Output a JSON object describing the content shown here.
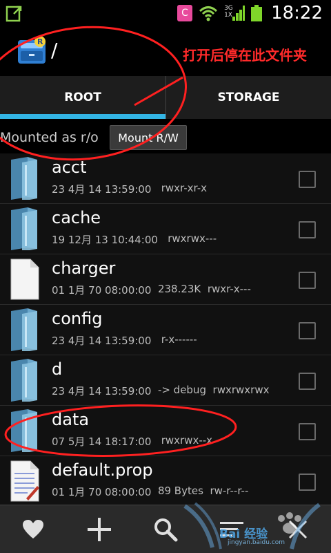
{
  "status_bar": {
    "time": "18:22",
    "network": "3G",
    "network2": "1X",
    "app_badge": "C",
    "colors": {
      "app_badge": "#e84a9c",
      "signal": "#7fd62a",
      "battery": "#7fd62a"
    }
  },
  "action_bar": {
    "path": "/",
    "annotation": "打开后停在此文件夹"
  },
  "tabs": [
    {
      "label": "ROOT",
      "active": true
    },
    {
      "label": "STORAGE",
      "active": false
    }
  ],
  "mount": {
    "status": "Mounted as r/o",
    "button_label": "Mount R/W"
  },
  "files": [
    {
      "name": "acct",
      "icon": "folder-icon",
      "date": "23 4月 14 13:59:00",
      "size": "",
      "perms": "rwxr-xr-x"
    },
    {
      "name": "cache",
      "icon": "folder-icon",
      "date": "19 12月 13 10:44:00",
      "size": "",
      "perms": "rwxrwx---"
    },
    {
      "name": "charger",
      "icon": "file-icon",
      "date": "01 1月 70 08:00:00",
      "size": "238.23K",
      "perms": "rwxr-x---"
    },
    {
      "name": "config",
      "icon": "folder-icon",
      "date": "23 4月 14 13:59:00",
      "size": "",
      "perms": "r-x------"
    },
    {
      "name": "d",
      "icon": "folder-icon",
      "date": "23 4月 14 13:59:00",
      "size": "-> debug",
      "perms": "rwxrwxrwx"
    },
    {
      "name": "data",
      "icon": "folder-icon",
      "date": "07 5月 14 18:17:00",
      "size": "",
      "perms": "rwxrwx--x"
    },
    {
      "name": "default.prop",
      "icon": "text-file-icon",
      "date": "01 1月 70 08:00:00",
      "size": "89 Bytes",
      "perms": "rw-r--r--"
    }
  ],
  "bottom_bar": [
    {
      "name": "favorites-button",
      "icon": "heart-icon"
    },
    {
      "name": "new-button",
      "icon": "plus-icon"
    },
    {
      "name": "search-button",
      "icon": "search-icon"
    },
    {
      "name": "sort-button",
      "icon": "sort-icon"
    },
    {
      "name": "close-button",
      "icon": "close-icon"
    }
  ],
  "watermark": {
    "text": "Bai 经验",
    "sub": "jingyan.baidu.com"
  },
  "colors": {
    "accent": "#33b5e5",
    "annotation": "#ff2a2a",
    "folder": "#5e9bbf"
  }
}
